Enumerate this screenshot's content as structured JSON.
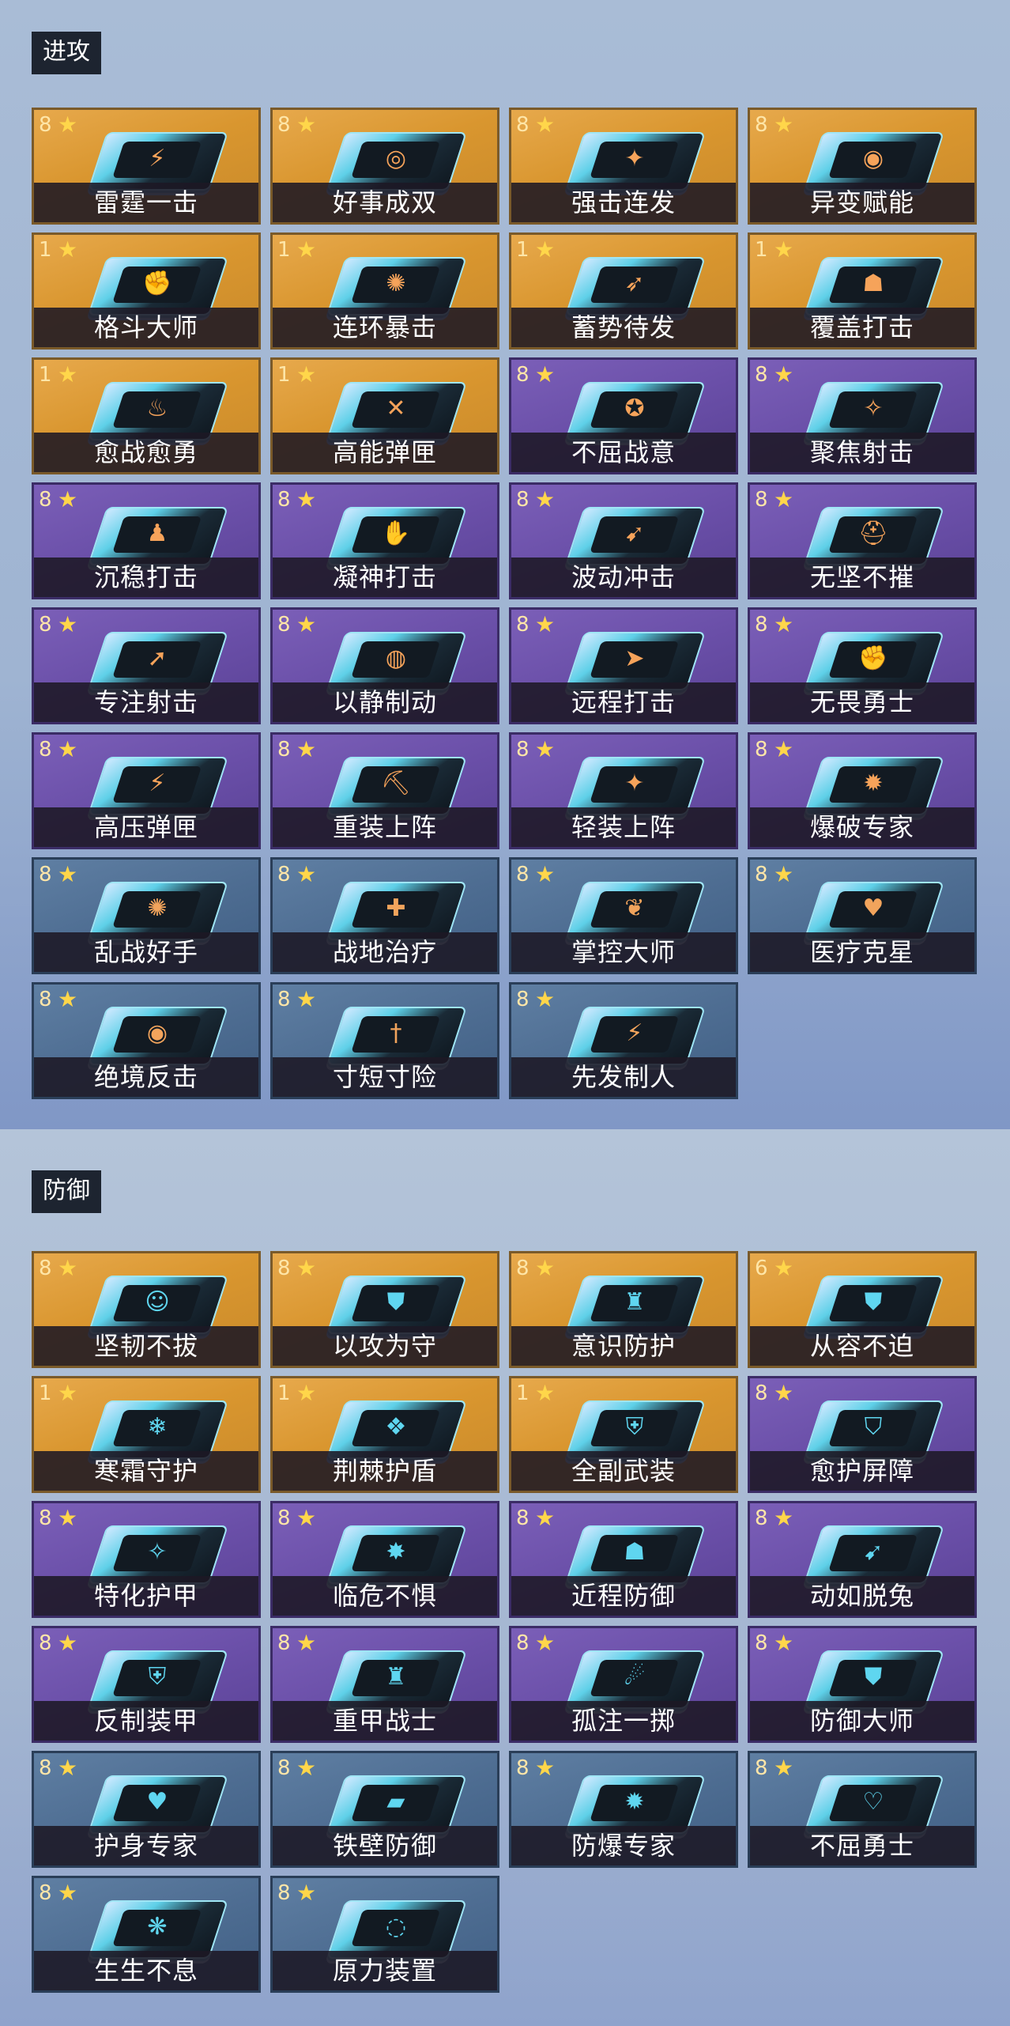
{
  "attack": {
    "title": "进攻",
    "cards": [
      {
        "level": "8",
        "name": "雷霆一击",
        "tier": "gold",
        "icon": "lightning-icon"
      },
      {
        "level": "8",
        "name": "好事成双",
        "tier": "gold",
        "icon": "double-icon"
      },
      {
        "level": "8",
        "name": "强击连发",
        "tier": "gold",
        "icon": "burst-icon"
      },
      {
        "level": "8",
        "name": "异变赋能",
        "tier": "gold",
        "icon": "mutation-icon"
      },
      {
        "level": "1",
        "name": "格斗大师",
        "tier": "gold",
        "icon": "fist-icon"
      },
      {
        "level": "1",
        "name": "连环暴击",
        "tier": "gold",
        "icon": "chain-icon"
      },
      {
        "level": "1",
        "name": "蓄势待发",
        "tier": "gold",
        "icon": "charge-icon"
      },
      {
        "level": "1",
        "name": "覆盖打击",
        "tier": "gold",
        "icon": "cover-icon"
      },
      {
        "level": "1",
        "name": "愈战愈勇",
        "tier": "gold",
        "icon": "flame-icon"
      },
      {
        "level": "1",
        "name": "高能弹匣",
        "tier": "gold",
        "icon": "magazine-icon"
      },
      {
        "level": "8",
        "name": "不屈战意",
        "tier": "purple",
        "icon": "will-icon"
      },
      {
        "level": "8",
        "name": "聚焦射击",
        "tier": "purple",
        "icon": "focus-icon"
      },
      {
        "level": "8",
        "name": "沉稳打击",
        "tier": "purple",
        "icon": "steady-icon"
      },
      {
        "level": "8",
        "name": "凝神打击",
        "tier": "purple",
        "icon": "arm-icon"
      },
      {
        "level": "8",
        "name": "波动冲击",
        "tier": "purple",
        "icon": "wave-icon"
      },
      {
        "level": "8",
        "name": "无坚不摧",
        "tier": "purple",
        "icon": "helmet-icon"
      },
      {
        "level": "8",
        "name": "专注射击",
        "tier": "purple",
        "icon": "bullet-icon"
      },
      {
        "level": "8",
        "name": "以静制动",
        "tier": "purple",
        "icon": "calm-icon"
      },
      {
        "level": "8",
        "name": "远程打击",
        "tier": "purple",
        "icon": "ranged-icon"
      },
      {
        "level": "8",
        "name": "无畏勇士",
        "tier": "purple",
        "icon": "warrior-icon"
      },
      {
        "level": "8",
        "name": "高压弹匣",
        "tier": "purple",
        "icon": "pressure-icon"
      },
      {
        "level": "8",
        "name": "重装上阵",
        "tier": "purple",
        "icon": "heavy-icon"
      },
      {
        "level": "8",
        "name": "轻装上阵",
        "tier": "purple",
        "icon": "light-icon"
      },
      {
        "level": "8",
        "name": "爆破专家",
        "tier": "purple",
        "icon": "explosive-icon"
      },
      {
        "level": "8",
        "name": "乱战好手",
        "tier": "blue",
        "icon": "melee-icon"
      },
      {
        "level": "8",
        "name": "战地治疗",
        "tier": "blue",
        "icon": "medkit-icon"
      },
      {
        "level": "8",
        "name": "掌控大师",
        "tier": "blue",
        "icon": "control-icon"
      },
      {
        "level": "8",
        "name": "医疗克星",
        "tier": "blue",
        "icon": "broken-heart-icon"
      },
      {
        "level": "8",
        "name": "绝境反击",
        "tier": "blue",
        "icon": "counter-icon"
      },
      {
        "level": "8",
        "name": "寸短寸险",
        "tier": "blue",
        "icon": "dagger-icon"
      },
      {
        "level": "8",
        "name": "先发制人",
        "tier": "blue",
        "icon": "strike-icon"
      }
    ]
  },
  "defense": {
    "title": "防御",
    "cards": [
      {
        "level": "8",
        "name": "坚韧不拔",
        "tier": "gold",
        "icon": "tenacity-icon"
      },
      {
        "level": "8",
        "name": "以攻为守",
        "tier": "gold",
        "icon": "attack-defend-icon"
      },
      {
        "level": "8",
        "name": "意识防护",
        "tier": "gold",
        "icon": "mind-shield-icon"
      },
      {
        "level": "6",
        "name": "从容不迫",
        "tier": "gold",
        "icon": "composure-icon"
      },
      {
        "level": "1",
        "name": "寒霜守护",
        "tier": "gold",
        "icon": "frost-icon"
      },
      {
        "level": "1",
        "name": "荆棘护盾",
        "tier": "gold",
        "icon": "thorn-shield-icon"
      },
      {
        "level": "1",
        "name": "全副武装",
        "tier": "gold",
        "icon": "armor-icon"
      },
      {
        "level": "8",
        "name": "愈护屏障",
        "tier": "purple",
        "icon": "heal-barrier-icon"
      },
      {
        "level": "8",
        "name": "特化护甲",
        "tier": "purple",
        "icon": "special-armor-icon"
      },
      {
        "level": "8",
        "name": "临危不惧",
        "tier": "purple",
        "icon": "fearless-icon"
      },
      {
        "level": "8",
        "name": "近程防御",
        "tier": "purple",
        "icon": "close-defense-icon"
      },
      {
        "level": "8",
        "name": "动如脱兔",
        "tier": "purple",
        "icon": "swift-icon"
      },
      {
        "level": "8",
        "name": "反制装甲",
        "tier": "purple",
        "icon": "counter-armor-icon"
      },
      {
        "level": "8",
        "name": "重甲战士",
        "tier": "purple",
        "icon": "heavy-armor-icon"
      },
      {
        "level": "8",
        "name": "孤注一掷",
        "tier": "purple",
        "icon": "gamble-icon"
      },
      {
        "level": "8",
        "name": "防御大师",
        "tier": "purple",
        "icon": "defense-master-icon"
      },
      {
        "level": "8",
        "name": "护身专家",
        "tier": "blue",
        "icon": "heart-guard-icon"
      },
      {
        "level": "8",
        "name": "铁壁防御",
        "tier": "blue",
        "icon": "iron-wall-icon"
      },
      {
        "level": "8",
        "name": "防爆专家",
        "tier": "blue",
        "icon": "blast-proof-icon"
      },
      {
        "level": "8",
        "name": "不屈勇士",
        "tier": "blue",
        "icon": "unyielding-icon"
      },
      {
        "level": "8",
        "name": "生生不息",
        "tier": "blue",
        "icon": "regen-icon"
      },
      {
        "level": "8",
        "name": "原力装置",
        "tier": "blue",
        "icon": "force-device-icon"
      }
    ]
  }
}
